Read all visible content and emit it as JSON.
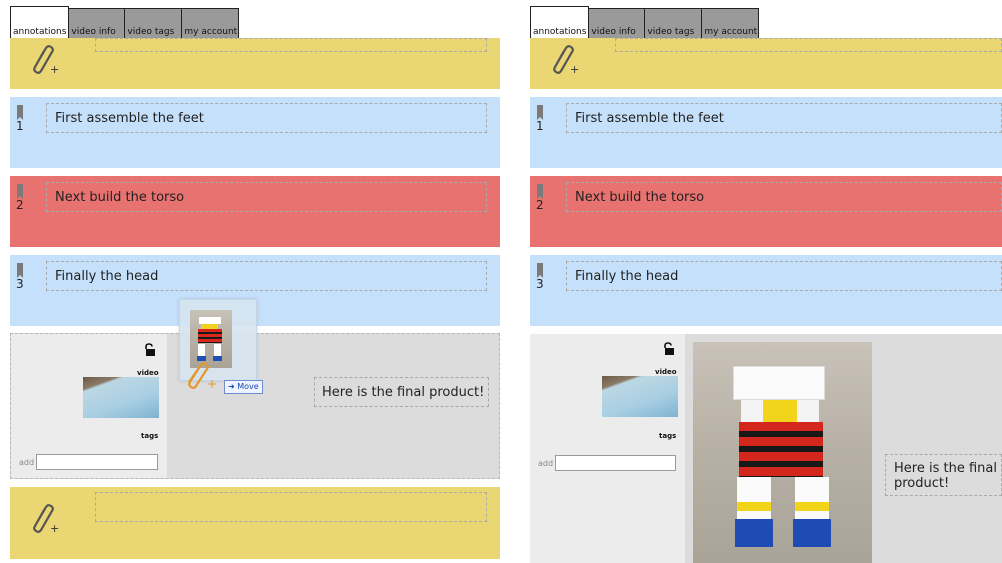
{
  "tabs": [
    {
      "label": "annotations",
      "active": true
    },
    {
      "label": "video info",
      "active": false
    },
    {
      "label": "video tags",
      "active": false
    },
    {
      "label": "my account",
      "active": false
    }
  ],
  "annotations": [
    {
      "number": "1",
      "text": "First assemble the feet",
      "color": "#c5e0fb"
    },
    {
      "number": "2",
      "text": "Next build the torso",
      "color": "#e8726f"
    },
    {
      "number": "3",
      "text": "Finally the head",
      "color": "#c5e0fb"
    }
  ],
  "clip": {
    "video_label": "video",
    "tags_label": "tags",
    "add_label": "add",
    "add_value": "",
    "final_text": "Here is the final product!"
  },
  "drag": {
    "move_label": "Move",
    "move_icon": "arrow-right-icon"
  },
  "colors": {
    "accent_yellow": "#ead672",
    "accent_blue": "#c5e0fb",
    "accent_red": "#e8726f",
    "clip_gray": "#dcdcdc"
  },
  "icons": [
    "paperclip-add-icon",
    "bookmark-icon",
    "unlock-icon",
    "arrow-right-icon"
  ]
}
